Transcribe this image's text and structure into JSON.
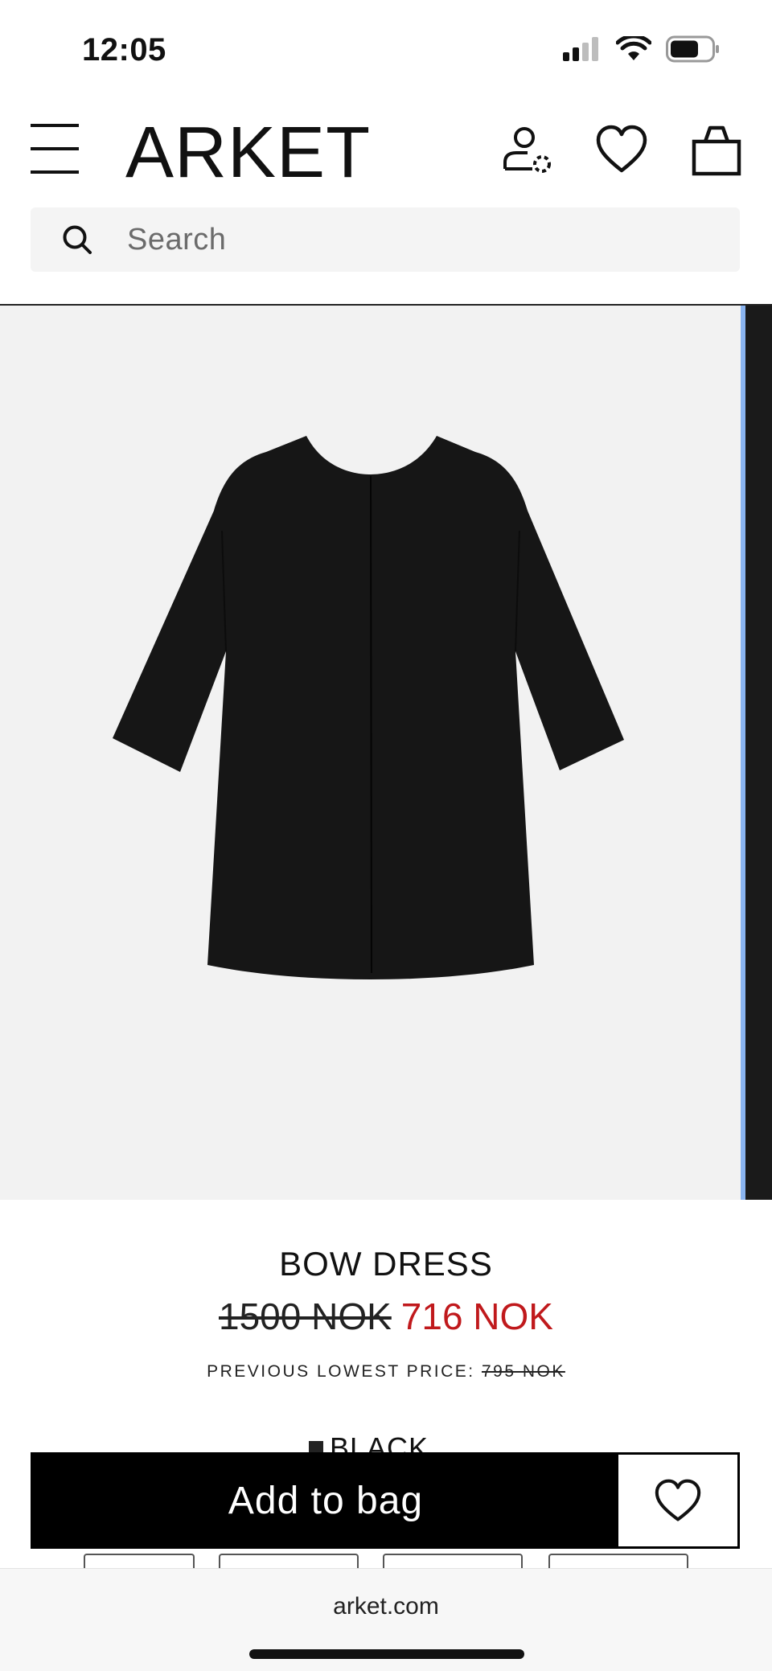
{
  "status_bar": {
    "time": "12:05",
    "signal_icon": "cellular-signal-icon",
    "wifi_icon": "wifi-icon",
    "battery_icon": "battery-icon"
  },
  "header": {
    "logo": "ARKET",
    "menu_icon": "hamburger-menu-icon",
    "account_icon": "account-icon",
    "wishlist_icon": "heart-icon",
    "bag_icon": "shopping-bag-icon"
  },
  "search": {
    "placeholder": "Search",
    "value": ""
  },
  "product": {
    "name": "BOW DRESS",
    "price_original": "1500 NOK",
    "price_sale": "716 NOK",
    "previous_lowest_label": "PREVIOUS LOWEST PRICE:",
    "previous_lowest_value": "795 NOK",
    "color": "BLACK",
    "image_alt": "black long-sleeve dress, back view"
  },
  "sticky": {
    "add_to_bag": "Add to bag",
    "wishlist_icon": "heart-icon"
  },
  "browser": {
    "url": "arket.com"
  },
  "colors": {
    "sale_red": "#c0191c",
    "button_black": "#000000",
    "image_bg": "#f2f2f2",
    "search_bg": "#f4f4f4"
  }
}
